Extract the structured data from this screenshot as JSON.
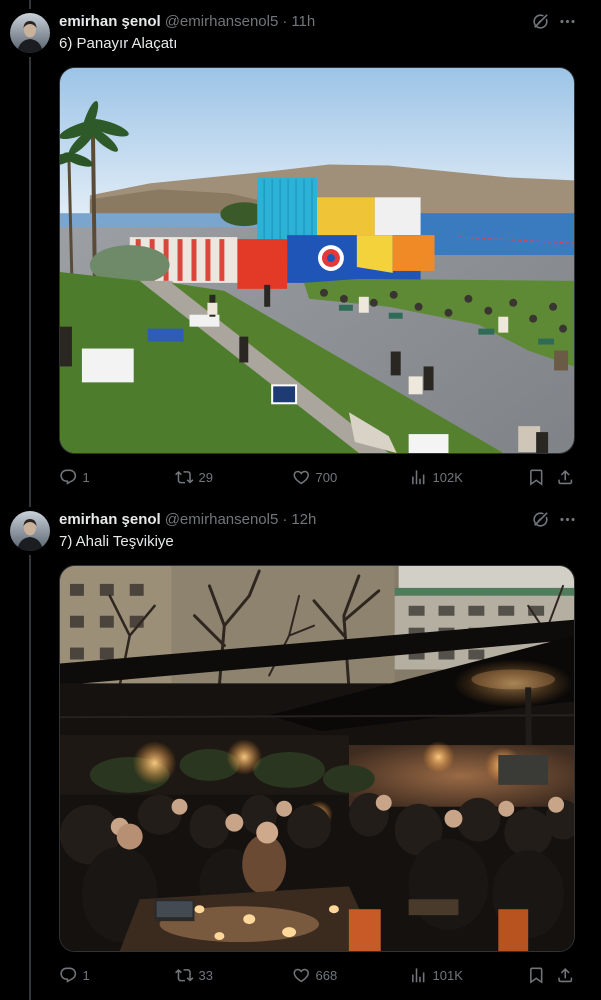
{
  "tweets": [
    {
      "author_name": "emirhan şenol",
      "handle": "@emirhansenol5",
      "separator": "·",
      "time": "11h",
      "text": "6) Panayır Alaçatı",
      "replies": "1",
      "retweets": "29",
      "likes": "700",
      "views": "102K"
    },
    {
      "author_name": "emirhan şenol",
      "handle": "@emirhansenol5",
      "separator": "·",
      "time": "12h",
      "text": "7) Ahali Teşvikiye",
      "replies": "1",
      "retweets": "33",
      "likes": "668",
      "views": "101K"
    }
  ],
  "icons": [
    "grok-icon",
    "more-icon",
    "reply-icon",
    "retweet-icon",
    "like-icon",
    "views-icon",
    "bookmark-icon",
    "share-icon"
  ],
  "colors": {
    "background": "#000000",
    "text": "#e7e9ea",
    "muted": "#71767b",
    "border": "#2f3336",
    "thread_line": "#333639"
  }
}
